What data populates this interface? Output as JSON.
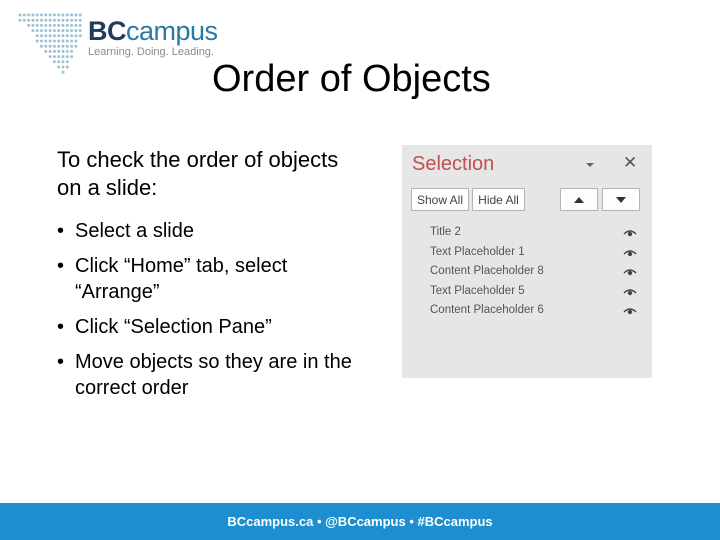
{
  "logo": {
    "name_bc": "BC",
    "name_campus": "campus",
    "tagline": "Learning. Doing. Leading.",
    "colors": {
      "dark": "#1f3c5a",
      "accent": "#2b78a7",
      "dots": "#9ec2d4"
    }
  },
  "slide": {
    "title": "Order of Objects",
    "intro": "To check the order of objects on a slide:",
    "bullets": [
      "Select a slide",
      "Click “Home” tab, select “Arrange”",
      "Click “Selection Pane”",
      "Move objects so they are in the correct order"
    ]
  },
  "selection_pane": {
    "title": "Selection",
    "show_all": "Show All",
    "hide_all": "Hide All",
    "items": [
      "Title 2",
      "Text Placeholder 1",
      "Content Placeholder 8",
      "Text Placeholder 5",
      "Content Placeholder 6"
    ],
    "icons": {
      "dropdown": "chevron-down-icon",
      "close": "close-icon",
      "up": "arrow-up-icon",
      "down": "arrow-down-icon",
      "visibility": "eye-icon"
    }
  },
  "footer": {
    "text": "BCcampus.ca • @BCcampus • #BCcampus",
    "color": "#1d8fd0"
  }
}
